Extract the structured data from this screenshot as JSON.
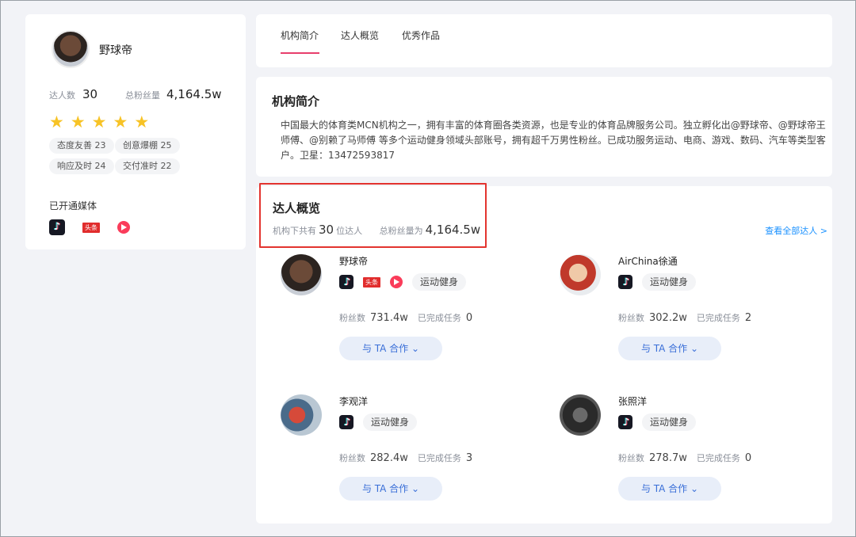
{
  "profile": {
    "name": "野球帝",
    "talent_count_label": "达人数",
    "talent_count": "30",
    "fans_label": "总粉丝量",
    "fans": "4,164.5w",
    "rating": 5,
    "tags": [
      "态度友善 23",
      "创意爆棚 25",
      "响应及时 24",
      "交付准时 22"
    ],
    "media_title": "已开通媒体",
    "media": [
      "douyin-icon",
      "toutiao-icon",
      "xigua-icon"
    ]
  },
  "tabs": [
    "机构简介",
    "达人概览",
    "优秀作品"
  ],
  "intro": {
    "title": "机构简介",
    "text": "中国最大的体育类MCN机构之一，拥有丰富的体育圈各类资源，也是专业的体育品牌服务公司。独立孵化出@野球帝、@野球帝王师傅、@别赖了马师傅 等多个运动健身领域头部账号，拥有超千万男性粉丝。已成功服务运动、电商、游戏、数码、汽车等类型客户。卫星：13472593817"
  },
  "overview": {
    "title": "达人概览",
    "sub_prefix": "机构下共有",
    "sub_count": "30",
    "sub_mid": "位达人",
    "sub_fans_label": "总粉丝量为",
    "sub_fans": "4,164.5w",
    "view_all": "查看全部达人 >"
  },
  "talents": [
    {
      "name": "野球帝",
      "category": "运动健身",
      "fans_label": "粉丝数",
      "fans": "731.4w",
      "tasks_label": "已完成任务",
      "tasks": "0",
      "button": "与 TA 合作 ⌄"
    },
    {
      "name": "AirChina徐通",
      "category": "运动健身",
      "fans_label": "粉丝数",
      "fans": "302.2w",
      "tasks_label": "已完成任务",
      "tasks": "2",
      "button": "与 TA 合作 ⌄"
    },
    {
      "name": "李观洋",
      "category": "运动健身",
      "fans_label": "粉丝数",
      "fans": "282.4w",
      "tasks_label": "已完成任务",
      "tasks": "3",
      "button": "与 TA 合作 ⌄"
    },
    {
      "name": "张照洋",
      "category": "运动健身",
      "fans_label": "粉丝数",
      "fans": "278.7w",
      "tasks_label": "已完成任务",
      "tasks": "0",
      "button": "与 TA 合作 ⌄"
    }
  ],
  "icon_text": {
    "toutiao": "头条"
  },
  "colors": {
    "accent": "#e83e6c",
    "highlight": "#e3342f",
    "link": "#1890ff",
    "star": "#f7c326"
  }
}
